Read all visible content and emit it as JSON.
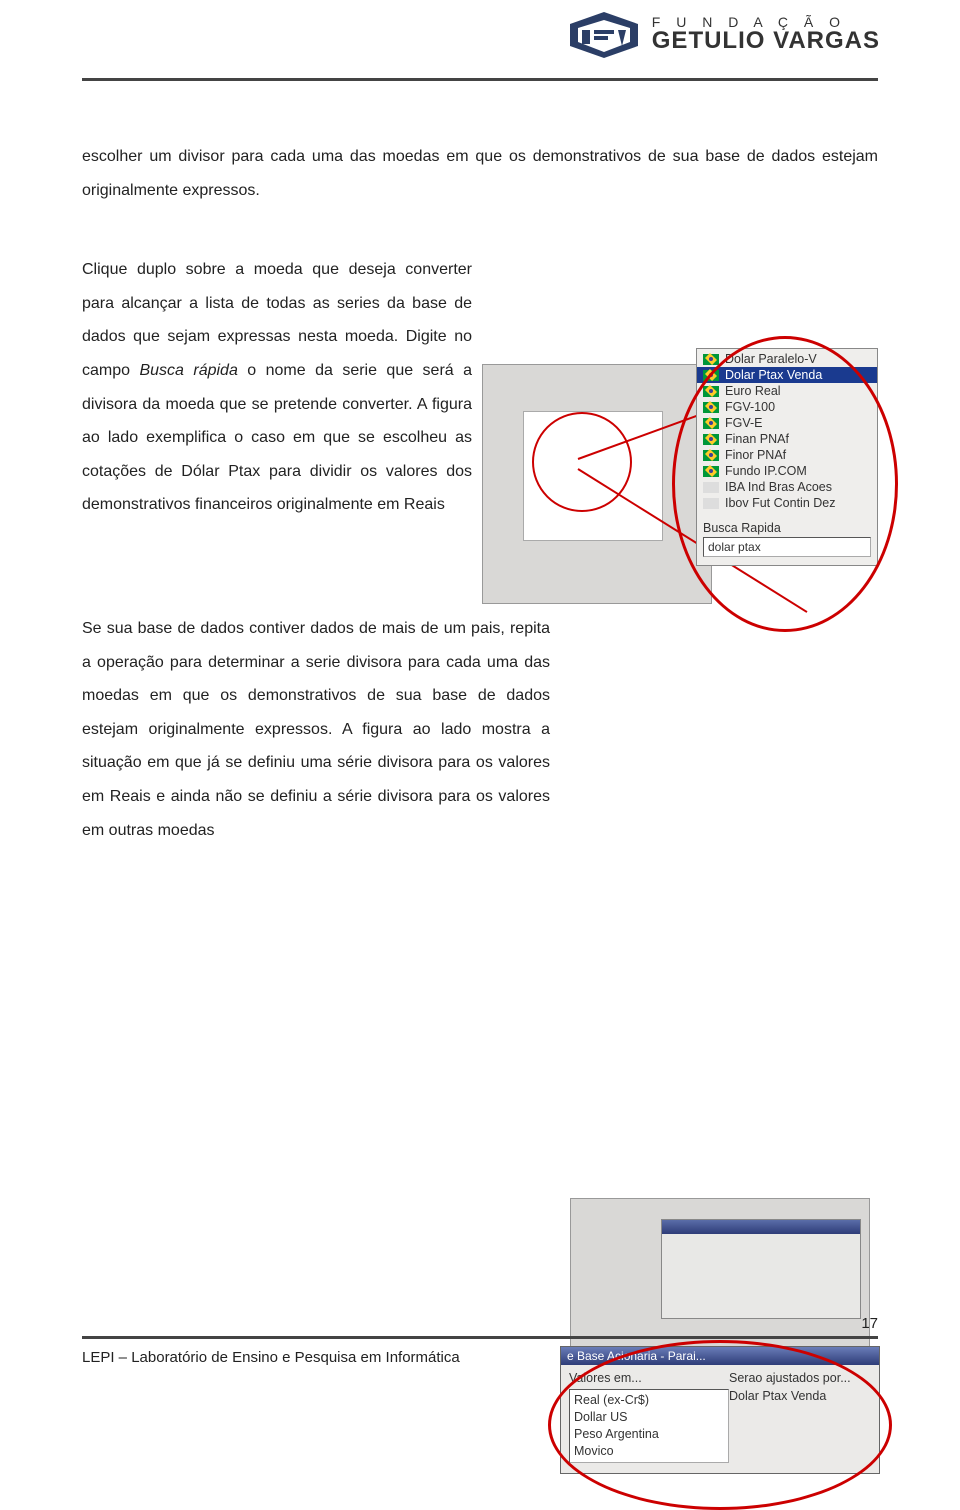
{
  "header": {
    "logo_line1": "F U N D A Ç Ã O",
    "logo_line2": "GETULIO VARGAS"
  },
  "body": {
    "p1": "escolher um divisor para cada uma das moedas em que os demonstrativos de sua base de dados estejam originalmente expressos.",
    "p2a": "Clique duplo sobre a moeda que deseja converter para alcançar a lista de todas as series da base de dados que sejam expressas nesta moeda. Digite no campo ",
    "p2_italic": "Busca rápida",
    "p2b": " o nome da serie que será a divisora da moeda que se pretende converter. A figura ao lado exemplifica o caso em que se escolheu as cotações de Dólar Ptax para dividir os valores dos demonstrativos financeiros originalmente em Reais",
    "p3": "Se sua base de dados contiver dados de mais de um pais, repita a operação para determinar a serie divisora para cada uma das moedas em que os demonstrativos de sua base de dados estejam originalmente expressos. A figura ao lado mostra a situação em que já se definiu uma série divisora para os valores em Reais e ainda não se definiu a série divisora para os valores em outras moedas"
  },
  "fig1": {
    "items_top": [
      "Dolar Paralelo-V"
    ],
    "item_selected": "Dolar Ptax Venda",
    "items_rest": [
      "Euro Real",
      "FGV-100",
      "FGV-E",
      "Finan PNAf",
      "Finor PNAf",
      "Fundo IP.COM",
      "IBA Ind Bras Acoes",
      "Ibov Fut Contin Dez"
    ],
    "search_label": "Busca Rapida",
    "search_value": "dolar ptax"
  },
  "fig2": {
    "titlebar": "e Base Acionaria - Parai...",
    "col1_label": "Valores em...",
    "col2_label": "Serao ajustados por...",
    "col1_items": [
      "Real (ex-Cr$)",
      "Dollar US",
      "Peso Argentina",
      "Movico"
    ],
    "col2_items": [
      "Dolar Ptax Venda"
    ]
  },
  "footer": {
    "page_number": "17",
    "text": "LEPI – Laboratório de Ensino e Pesquisa em Informática"
  }
}
